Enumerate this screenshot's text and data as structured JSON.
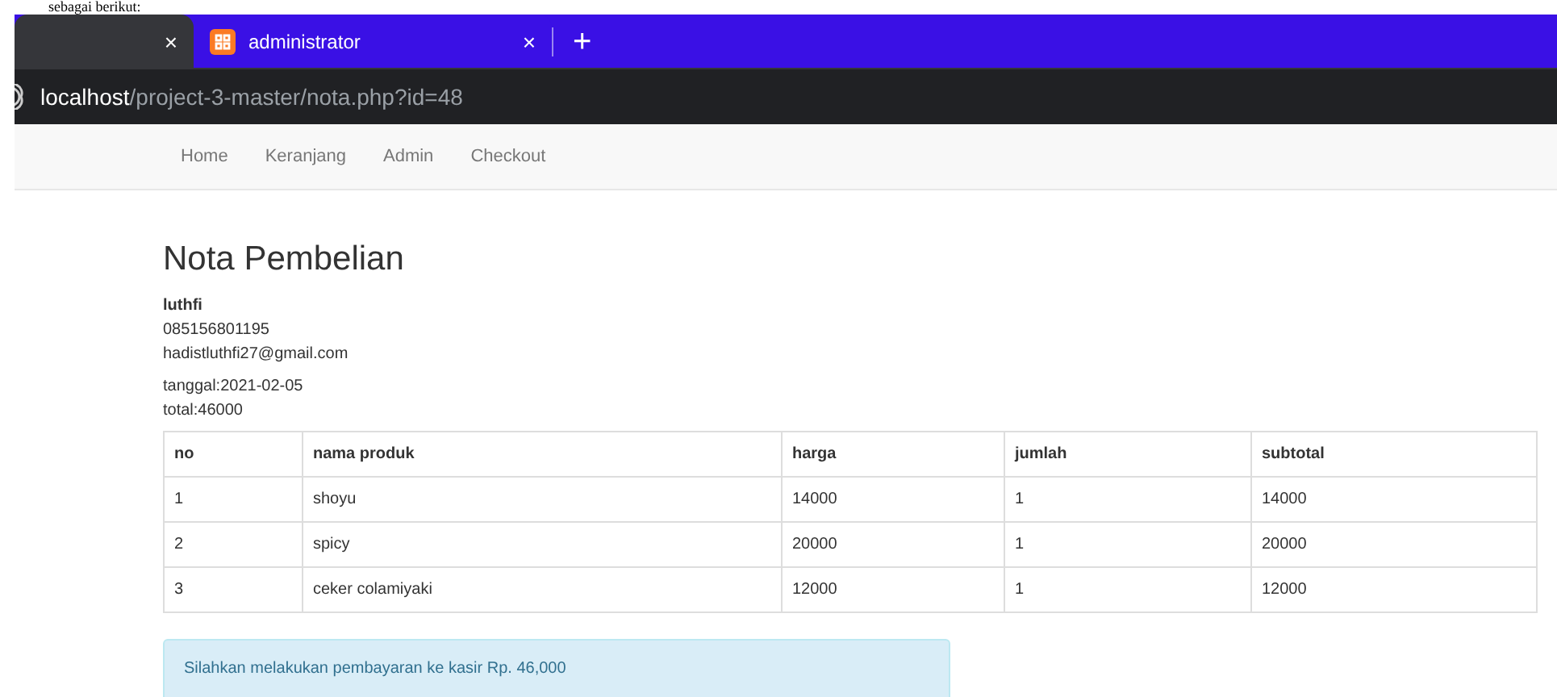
{
  "document_text": "sebagai berikut:",
  "browser": {
    "tabs": [
      {
        "close": "×",
        "selected": true
      },
      {
        "title": "administrator",
        "close": "×",
        "selected": false
      }
    ],
    "new_tab": "+",
    "url_host": "localhost",
    "url_path": "/project-3-master/nota.php?id=48"
  },
  "navbar": {
    "links": [
      "Home",
      "Keranjang",
      "Admin",
      "Checkout"
    ]
  },
  "title": "Nota Pembelian",
  "customer": {
    "name": "luthfi",
    "phone": "085156801195",
    "email": "hadistluthfi27@gmail.com"
  },
  "order": {
    "date": "tanggal:2021-02-05",
    "total": "total:46000"
  },
  "table": {
    "columns": [
      "no",
      "nama produk",
      "harga",
      "jumlah",
      "subtotal"
    ],
    "rows": [
      [
        "1",
        "shoyu",
        "14000",
        "1",
        "14000"
      ],
      [
        "2",
        "spicy",
        "20000",
        "1",
        "20000"
      ],
      [
        "3",
        "ceker colamiyaki",
        "12000",
        "1",
        "12000"
      ]
    ]
  },
  "alert": "Silahkan melakukan pembayaran ke kasir Rp. 46,000"
}
